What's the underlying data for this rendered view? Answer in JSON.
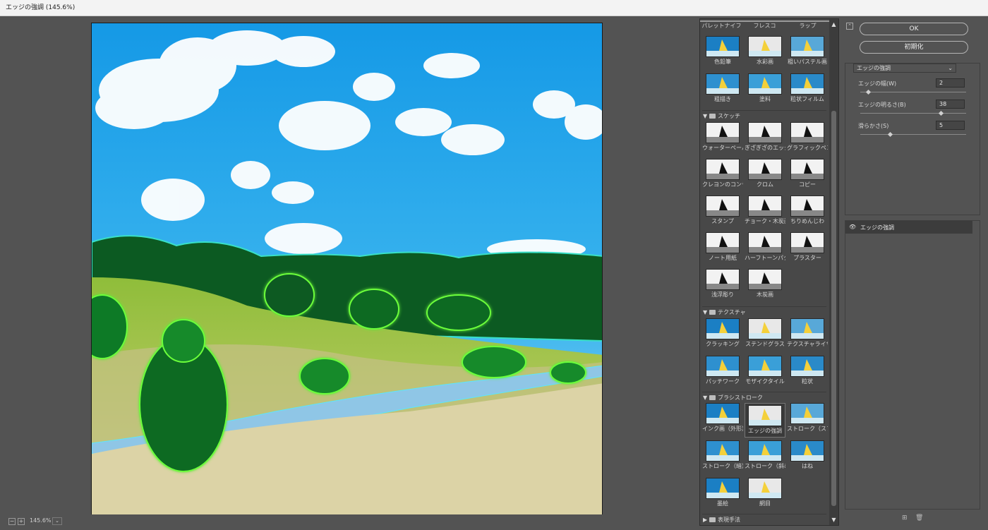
{
  "window": {
    "title": "エッジの強調 (145.6%)"
  },
  "status": {
    "zoom": "145.6%",
    "zoom_minus": "−",
    "zoom_plus": "+",
    "dropdown": "⌄"
  },
  "gallery": {
    "top_labels": [
      "パレットナイフ",
      "フレスコ",
      "ラップ"
    ],
    "art_items": [
      "色鉛筆",
      "水彩画",
      "粗いパステル画",
      "粗描き",
      "塗料",
      "粒状フィルム"
    ],
    "sketch": {
      "title": "スケッチ",
      "items": [
        "ウォーターペーパー",
        "ぎざぎざのエッジ",
        "グラフィックペン",
        "クレヨンのコンテ画",
        "クロム",
        "コピー",
        "スタンプ",
        "チョーク・木炭画",
        "ちりめんじわ",
        "ノート用紙",
        "ハーフトーンパターン",
        "プラスター",
        "浅浮彫り",
        "木炭画"
      ]
    },
    "texture": {
      "title": "テクスチャ",
      "items": [
        "クラッキング",
        "ステンドグラス",
        "テクスチャライザー",
        "パッチワーク",
        "モザイクタイル",
        "粒状"
      ]
    },
    "brush": {
      "title": "ブラシストローク",
      "items": [
        "インク画（外形）",
        "エッジの強調",
        "ストローク（スプレー）",
        "ストローク（暗）",
        "ストローク（斜め）",
        "はね",
        "墨絵",
        "網目"
      ]
    },
    "artistic": {
      "title": "表現手法"
    },
    "scroll_up": "▲",
    "scroll_down": "▼",
    "tri_open": "▼",
    "tri_closed": "▶"
  },
  "settings": {
    "ok": "OK",
    "reset": "初期化",
    "collapse": "⌃",
    "filter_select": "エッジの強調",
    "select_chevron": "⌄",
    "params": [
      {
        "label": "エッジの幅(W)",
        "value": "2",
        "fraction": 0.07
      },
      {
        "label": "エッジの明るさ(B)",
        "value": "38",
        "fraction": 0.76
      },
      {
        "label": "滑らかさ(S)",
        "value": "5",
        "fraction": 0.28
      }
    ]
  },
  "layers": {
    "active": "エッジの強調",
    "eye": "👁",
    "new_icon": "⊞",
    "delete_icon": "🗑"
  },
  "colors": {
    "sky": "#1aa4ea",
    "grass": "#c7c98a",
    "tree": "#0c6a22",
    "glow": "#6cff3a"
  }
}
